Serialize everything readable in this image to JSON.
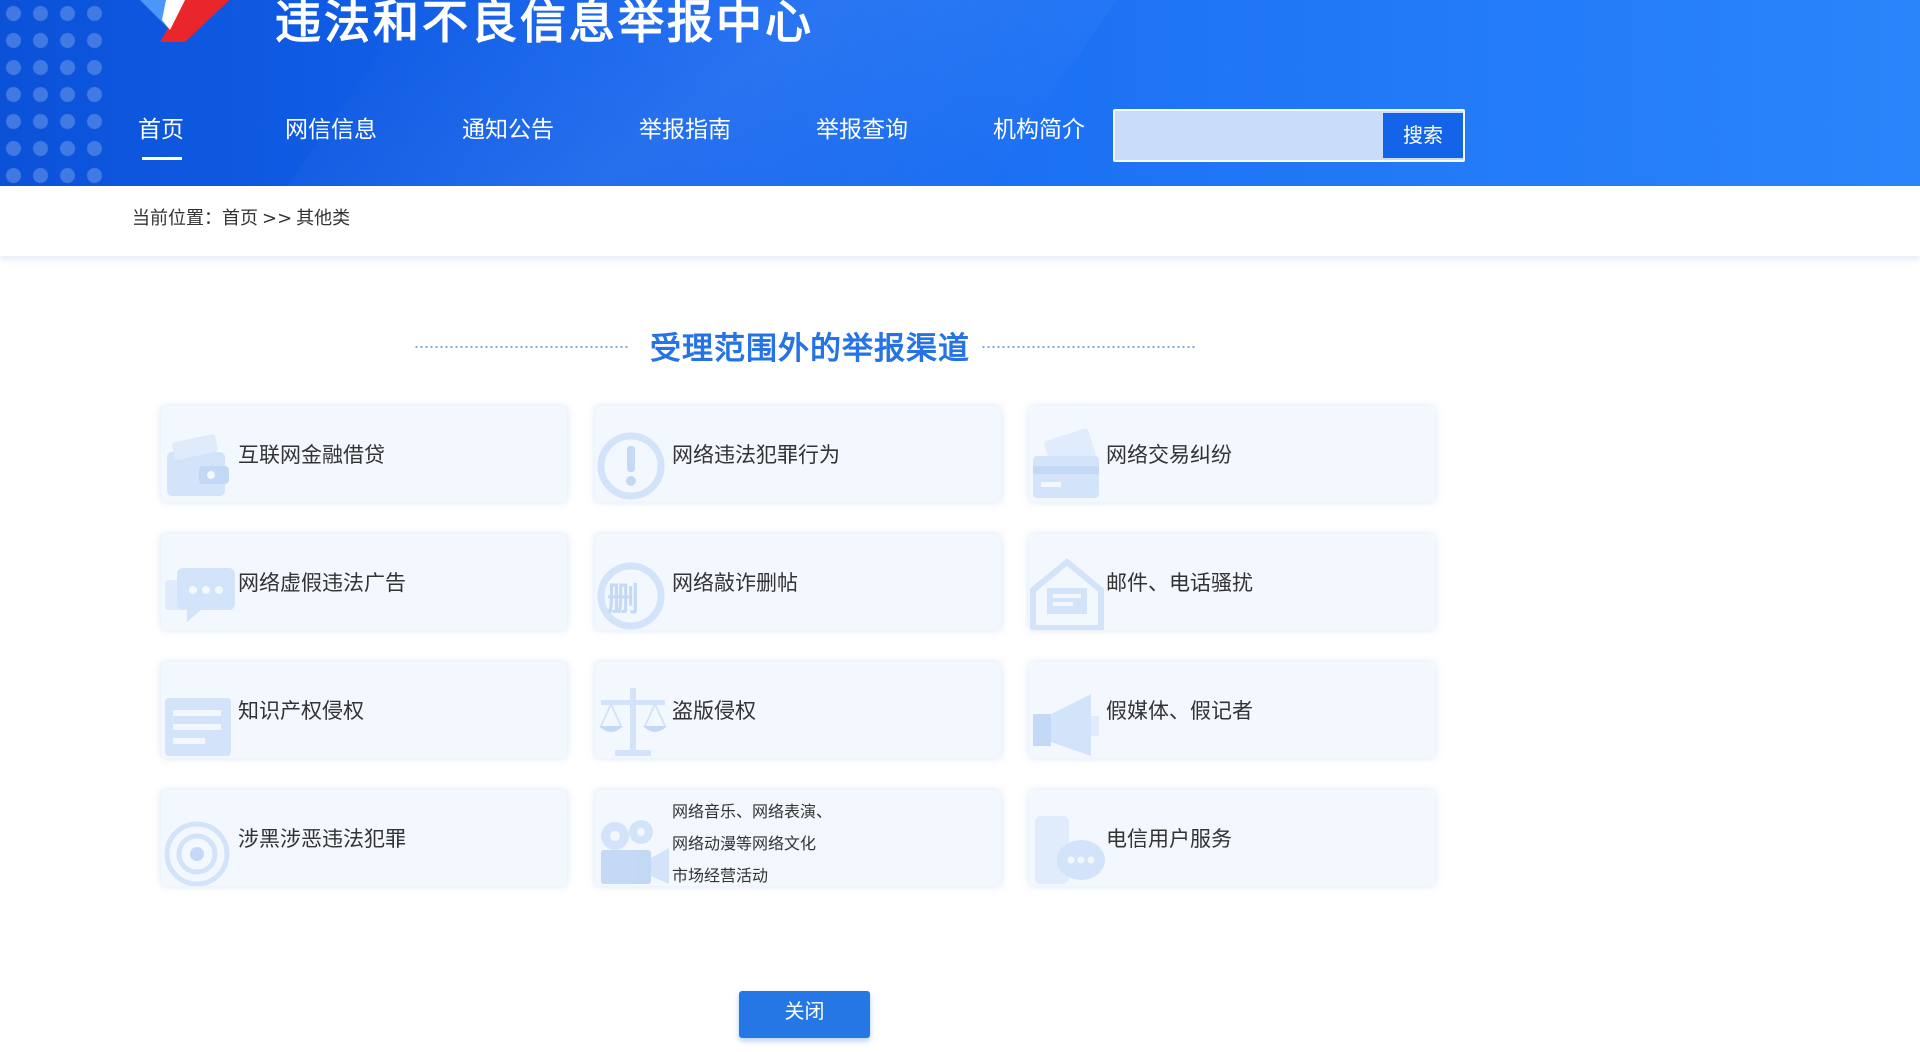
{
  "header": {
    "site_title": "违法和不良信息举报中心",
    "nav": [
      {
        "label": "首页",
        "active": true
      },
      {
        "label": "网信信息",
        "active": false
      },
      {
        "label": "通知公告",
        "active": false
      },
      {
        "label": "举报指南",
        "active": false
      },
      {
        "label": "举报查询",
        "active": false
      },
      {
        "label": "机构简介",
        "active": false
      }
    ],
    "search": {
      "value": "",
      "placeholder": "",
      "button_label": "搜索"
    },
    "colors": {
      "primary": "#1565ee",
      "accent_red": "#e8262b"
    }
  },
  "breadcrumb": {
    "prefix": "当前位置：",
    "home": "首页",
    "separator": ">>",
    "current": "其他类"
  },
  "section": {
    "title": "受理范围外的举报渠道",
    "title_color": "#2673e6"
  },
  "cards": [
    {
      "label": "互联网金融借贷",
      "icon": "wallet-icon"
    },
    {
      "label": "网络违法犯罪行为",
      "icon": "alert-circle-icon"
    },
    {
      "label": "网络交易纠纷",
      "icon": "credit-card-icon"
    },
    {
      "label": "网络虚假违法广告",
      "icon": "chat-bubble-icon"
    },
    {
      "label": "网络敲诈删帖",
      "icon": "delete-post-icon"
    },
    {
      "label": "邮件、电话骚扰",
      "icon": "mail-icon"
    },
    {
      "label": "知识产权侵权",
      "icon": "document-list-icon"
    },
    {
      "label": "盗版侵权",
      "icon": "scales-icon"
    },
    {
      "label": "假媒体、假记者",
      "icon": "megaphone-icon"
    },
    {
      "label": "涉黑涉恶违法犯罪",
      "icon": "target-icon"
    },
    {
      "label_lines": [
        "网络音乐、网络表演、",
        "网络动漫等网络文化",
        "市场经营活动"
      ],
      "icon": "film-camera-icon"
    },
    {
      "label": "电信用户服务",
      "icon": "phone-chat-icon"
    }
  ],
  "close_button": {
    "label": "关闭"
  }
}
